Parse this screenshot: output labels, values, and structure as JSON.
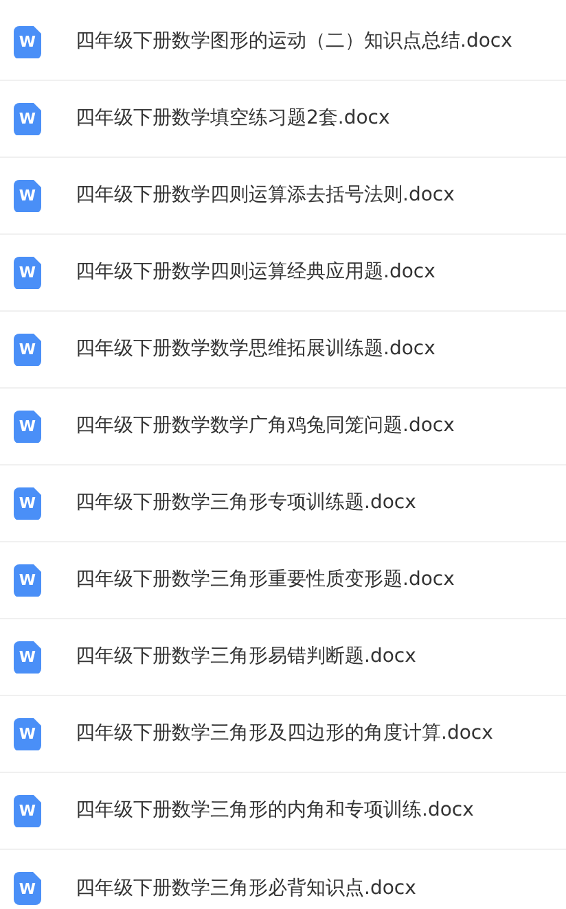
{
  "files": [
    {
      "icon_label": "W",
      "name": "四年级下册数学图形的运动（二）知识点总结.docx"
    },
    {
      "icon_label": "W",
      "name": "四年级下册数学填空练习题2套.docx"
    },
    {
      "icon_label": "W",
      "name": "四年级下册数学四则运算添去括号法则.docx"
    },
    {
      "icon_label": "W",
      "name": "四年级下册数学四则运算经典应用题.docx"
    },
    {
      "icon_label": "W",
      "name": "四年级下册数学数学思维拓展训练题.docx"
    },
    {
      "icon_label": "W",
      "name": "四年级下册数学数学广角鸡兔同笼问题.docx"
    },
    {
      "icon_label": "W",
      "name": "四年级下册数学三角形专项训练题.docx"
    },
    {
      "icon_label": "W",
      "name": "四年级下册数学三角形重要性质变形题.docx"
    },
    {
      "icon_label": "W",
      "name": "四年级下册数学三角形易错判断题.docx"
    },
    {
      "icon_label": "W",
      "name": "四年级下册数学三角形及四边形的角度计算.docx"
    },
    {
      "icon_label": "W",
      "name": "四年级下册数学三角形的内角和专项训练.docx"
    },
    {
      "icon_label": "W",
      "name": "四年级下册数学三角形必背知识点.docx"
    }
  ]
}
